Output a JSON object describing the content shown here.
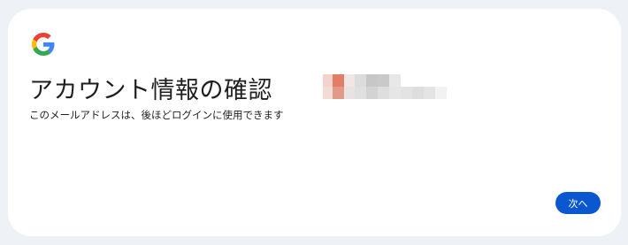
{
  "brand": {
    "logo_icon": "google-g-logo-icon",
    "colors": {
      "blue": "#4285F4",
      "red": "#EA4335",
      "yellow": "#FBBC05",
      "green": "#34A853"
    }
  },
  "page": {
    "title": "アカウント情報の確認",
    "subtitle": "このメールアドレスは、後ほどログインに使用できます"
  },
  "email": {
    "redacted": true
  },
  "actions": {
    "next_label": "次へ"
  },
  "colors": {
    "primary_button": "#0b57d0",
    "background": "#eef1f6",
    "card": "#ffffff"
  }
}
